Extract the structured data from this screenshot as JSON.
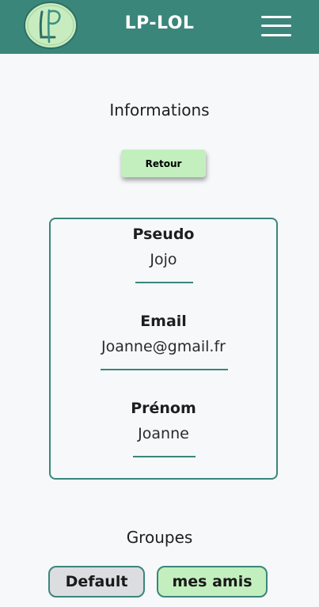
{
  "header": {
    "app_title": "LP-LOL",
    "logo_letters": "LP",
    "menu_icon": "hamburger-menu-icon"
  },
  "page": {
    "title": "Informations",
    "back_label": "Retour"
  },
  "profile": {
    "fields": [
      {
        "label": "Pseudo",
        "value": "Jojo"
      },
      {
        "label": "Email",
        "value": "Joanne@gmail.fr"
      },
      {
        "label": "Prénom",
        "value": "Joanne"
      }
    ]
  },
  "groups": {
    "title": "Groupes",
    "items": [
      {
        "label": "Default"
      },
      {
        "label": "mes amis"
      }
    ]
  },
  "colors": {
    "header_bg": "#3a867b",
    "accent": "#3a867b",
    "button_green": "#c3efbe",
    "chip_grey": "#dcdde1",
    "page_bg": "#f6f8fa"
  }
}
